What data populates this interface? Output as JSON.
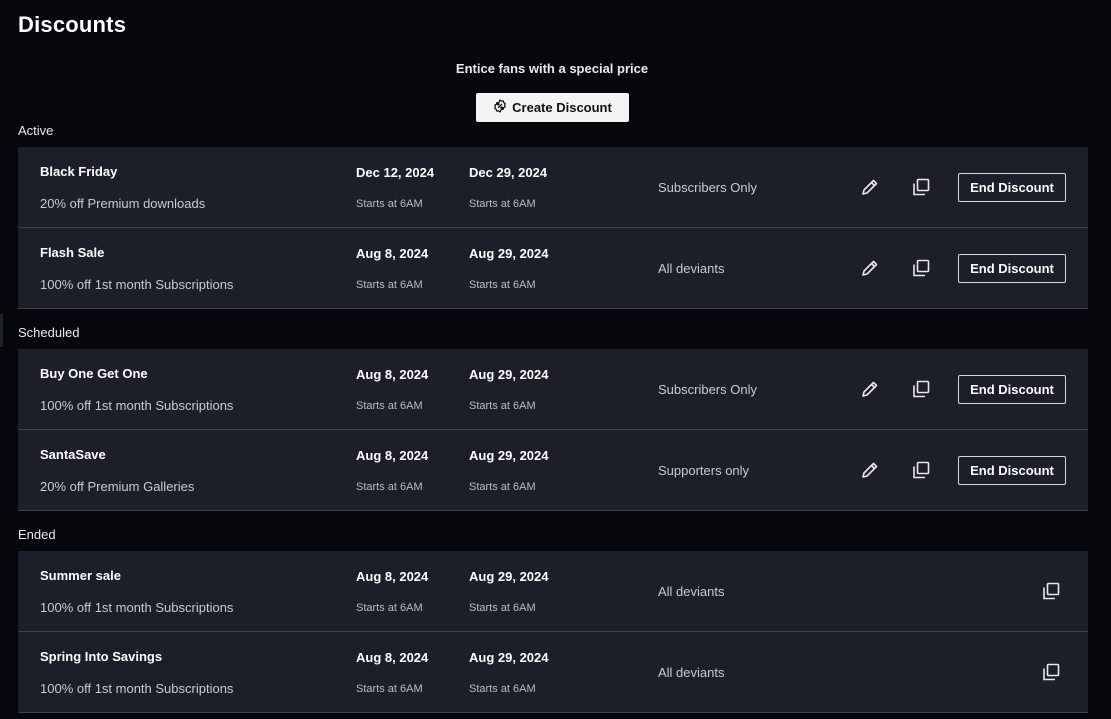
{
  "header": {
    "title": "Discounts",
    "subtitle": "Entice fans with a special price",
    "create_label": "Create Discount"
  },
  "sections": {
    "active": {
      "label": "Active",
      "rows": [
        {
          "name": "Black Friday",
          "desc": "20% off Premium downloads",
          "start": "Dec 12, 2024",
          "start_time": "Starts at 6AM",
          "end": "Dec 29, 2024",
          "end_time": "Starts at 6AM",
          "audience": "Subscribers Only",
          "action": "End Discount"
        },
        {
          "name": "Flash Sale",
          "desc": "100% off 1st month Subscriptions",
          "start": "Aug 8, 2024",
          "start_time": "Starts at 6AM",
          "end": "Aug 29, 2024",
          "end_time": "Starts at 6AM",
          "audience": "All deviants",
          "action": "End Discount"
        }
      ]
    },
    "scheduled": {
      "label": "Scheduled",
      "rows": [
        {
          "name": "Buy One Get One",
          "desc": "100% off 1st month Subscriptions",
          "start": "Aug 8, 2024",
          "start_time": "Starts at 6AM",
          "end": "Aug 29, 2024",
          "end_time": "Starts at 6AM",
          "audience": "Subscribers Only",
          "action": "End Discount"
        },
        {
          "name": "SantaSave",
          "desc": "20% off Premium Galleries",
          "start": "Aug 8, 2024",
          "start_time": "Starts at 6AM",
          "end": "Aug 29, 2024",
          "end_time": "Starts at 6AM",
          "audience": "Supporters only",
          "action": "End Discount"
        }
      ]
    },
    "ended": {
      "label": "Ended",
      "rows": [
        {
          "name": "Summer sale",
          "desc": "100% off 1st month Subscriptions",
          "start": "Aug 8, 2024",
          "start_time": "Starts at 6AM",
          "end": "Aug 29, 2024",
          "end_time": "Starts at 6AM",
          "audience": "All deviants"
        },
        {
          "name": "Spring Into Savings",
          "desc": "100% off 1st month Subscriptions",
          "start": "Aug 8, 2024",
          "start_time": "Starts at 6AM",
          "end": "Aug 29, 2024",
          "end_time": "Starts at 6AM",
          "audience": "All deviants"
        }
      ]
    }
  },
  "icons": {
    "create": "discount-badge-icon",
    "edit": "pencil-icon",
    "duplicate": "duplicate-icon"
  }
}
